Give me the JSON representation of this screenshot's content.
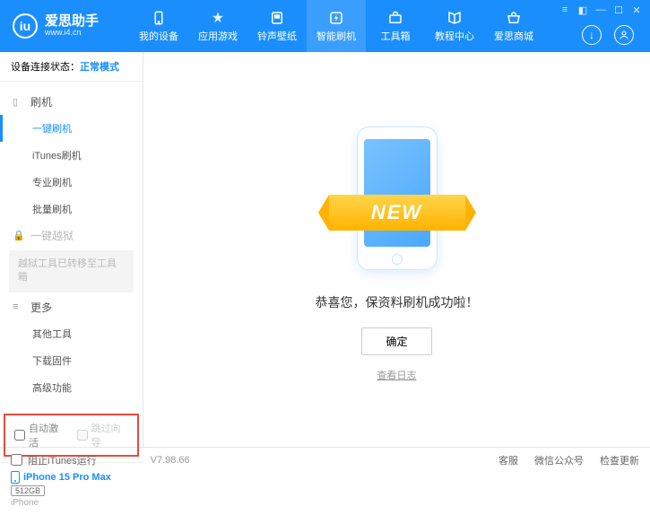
{
  "brand": {
    "title": "爱思助手",
    "subtitle": "www.i4.cn",
    "logo_letter": "iu"
  },
  "nav": [
    {
      "label": "我的设备",
      "icon": "phone"
    },
    {
      "label": "应用游戏",
      "icon": "app"
    },
    {
      "label": "铃声壁纸",
      "icon": "ring"
    },
    {
      "label": "智能刷机",
      "icon": "flash"
    },
    {
      "label": "工具箱",
      "icon": "tool"
    },
    {
      "label": "教程中心",
      "icon": "help"
    },
    {
      "label": "爱思商城",
      "icon": "shop"
    }
  ],
  "status": {
    "label": "设备连接状态：",
    "mode": "正常模式"
  },
  "sidebar": {
    "flash_head": "刷机",
    "flash_items": [
      "一键刷机",
      "iTunes刷机",
      "专业刷机",
      "批量刷机"
    ],
    "jailbreak_head": "一键越狱",
    "jailbreak_note": "越狱工具已转移至工具箱",
    "more_head": "更多",
    "more_items": [
      "其他工具",
      "下载固件",
      "高级功能"
    ]
  },
  "options": {
    "auto_activate": "自动激活",
    "skip_guide": "跳过向导"
  },
  "device": {
    "name": "iPhone 15 Pro Max",
    "storage": "512GB",
    "type": "iPhone"
  },
  "main": {
    "banner": "NEW",
    "message": "恭喜您，保资料刷机成功啦！",
    "ok": "确定",
    "log_link": "查看日志"
  },
  "footer": {
    "block_itunes": "阻止iTunes运行",
    "version": "V7.98.66",
    "links": [
      "客服",
      "微信公众号",
      "检查更新"
    ]
  }
}
